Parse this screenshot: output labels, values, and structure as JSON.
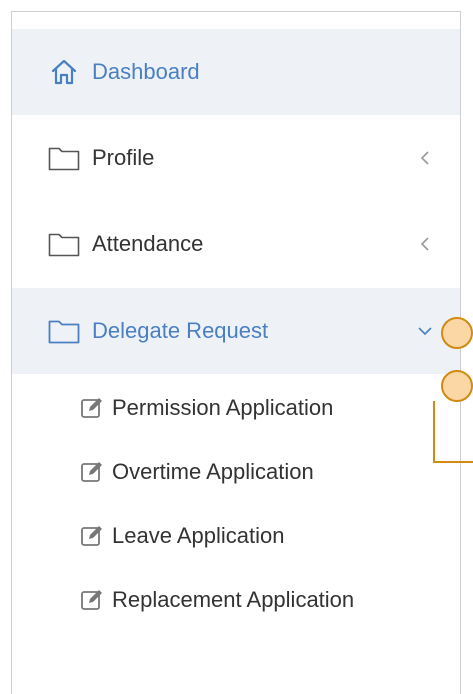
{
  "menu": {
    "items": [
      {
        "label": "Dashboard",
        "icon": "home-icon",
        "active": true,
        "chevron": ""
      },
      {
        "label": "Profile",
        "icon": "folder-icon",
        "active": false,
        "chevron": "<"
      },
      {
        "label": "Attendance",
        "icon": "folder-icon",
        "active": false,
        "chevron": "<"
      },
      {
        "label": "Delegate Request",
        "icon": "folder-icon",
        "active": true,
        "chevron": "v"
      }
    ],
    "subitems": [
      {
        "label": "Permission Application",
        "icon": "edit-icon"
      },
      {
        "label": "Overtime Application",
        "icon": "edit-icon"
      },
      {
        "label": "Leave Application",
        "icon": "edit-icon"
      },
      {
        "label": "Replacement Application",
        "icon": "edit-icon"
      }
    ]
  },
  "colors": {
    "accent": "#4a7fc1",
    "active_bg": "#eef2f7",
    "text": "#333333",
    "marker_fill": "#fbd7a6",
    "marker_border": "#d28a12"
  }
}
